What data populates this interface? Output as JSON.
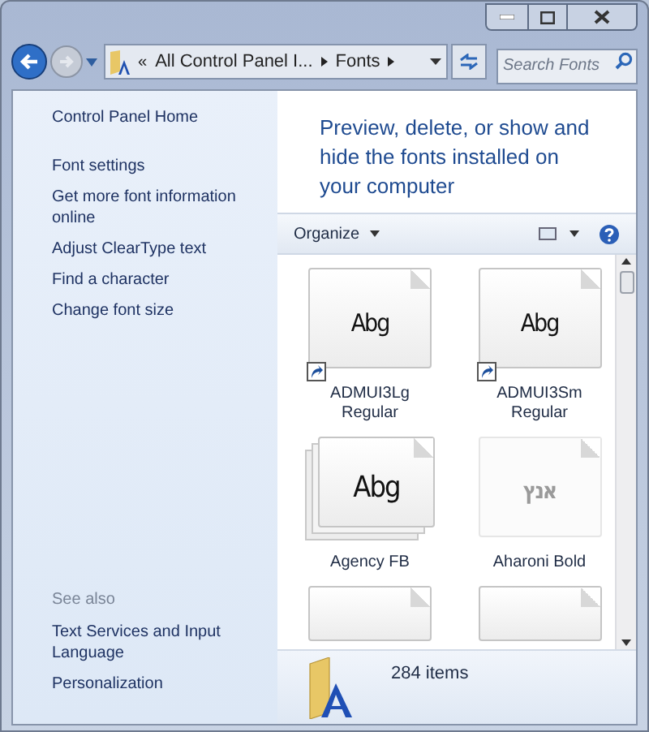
{
  "nav": {
    "crumbs": [
      "«",
      "All Control Panel I...",
      "Fonts"
    ],
    "search": {
      "placeholder": "Search Fonts"
    }
  },
  "sidebar": {
    "home": "Control Panel Home",
    "tasks": [
      "Font settings",
      "Get more font information online",
      "Adjust ClearType text",
      "Find a character",
      "Change font size"
    ],
    "see_also": {
      "heading": "See also",
      "links": [
        "Text Services and Input Language",
        "Personalization"
      ]
    }
  },
  "header": "Preview, delete, or show and hide the fonts installed on your computer",
  "toolbar": {
    "organize": "Organize"
  },
  "tiles": [
    {
      "kind": "shortcut",
      "sample": "Abg",
      "name": "ADMUI3Lg Regular"
    },
    {
      "kind": "shortcut",
      "sample": "Abg",
      "name": "ADMUI3Sm Regular"
    },
    {
      "kind": "family",
      "sample": "Abg",
      "name": "Agency FB"
    },
    {
      "kind": "hidden",
      "sample": "אנץ",
      "name": "Aharoni Bold"
    },
    {
      "kind": "cut"
    },
    {
      "kind": "cut"
    }
  ],
  "status_bar": {
    "count": "284 items"
  }
}
